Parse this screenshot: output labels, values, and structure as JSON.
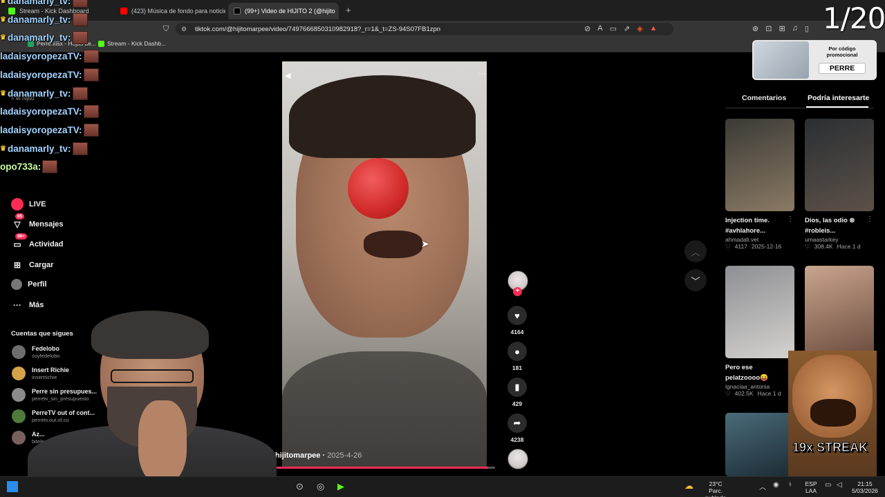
{
  "browser": {
    "tabs": [
      {
        "label": "Stream - Kick Dashboard",
        "active": false
      },
      {
        "label": "(423) Música de fondo para noticiero",
        "active": false
      },
      {
        "label": "(99+) Video de HIJITO 2 (@hijito",
        "active": true
      }
    ],
    "url": "tiktok.com/@hijitomarpee/video/7497666850310982918?_r=1&_t=ZS-94S07FB1zpn",
    "bookmarks": [
      "Perre.xlsx - Hojas de...",
      "Stream - Kick Dashb..."
    ],
    "new_tab_symbol": "+"
  },
  "chat_overlay": [
    {
      "name": "danamarly_tv:",
      "style": "crown"
    },
    {
      "name": "danamarly_tv:",
      "style": "crown"
    },
    {
      "name": "danamarly_tv:",
      "style": "crown"
    },
    {
      "name": "ladaisyoropezaTV:",
      "style": "plain"
    },
    {
      "name": "ladaisyoropezaTV:",
      "style": "plain"
    },
    {
      "name": "danamarly_tv:",
      "style": "crown"
    },
    {
      "name": "ladaisyoropezaTV:",
      "style": "plain"
    },
    {
      "name": "ladaisyoropezaTV:",
      "style": "plain"
    },
    {
      "name": "danamarly_tv:",
      "style": "crown"
    },
    {
      "name": "opo733a:",
      "style": "green"
    }
  ],
  "tiktok": {
    "search_placeholder": "el hijito",
    "nav": {
      "live": "LIVE",
      "messages": "Mensajes",
      "messages_badge": "85",
      "activity": "Actividad",
      "activity_badge": "99+",
      "upload": "Cargar",
      "profile": "Perfil",
      "more": "Más"
    },
    "following_header": "Cuentas que sigues",
    "following": [
      {
        "name": "Fedelobo",
        "handle": "soyfedelobo",
        "color": "#6d6d6d"
      },
      {
        "name": "Insert Richie",
        "handle": "insertrichie",
        "color": "#d3a24a"
      },
      {
        "name": "Perre sin presupues...",
        "handle": "perretv_sin_presupuesto",
        "color": "#8b8b8b"
      },
      {
        "name": "PerreTV out of cont...",
        "handle": "perretv.out.of.co",
        "color": "#4f7a3d"
      },
      {
        "name": "Az...",
        "handle": "bitele...",
        "color": "#7a5f5f"
      }
    ],
    "video": {
      "author": "hijitomarpee",
      "date": "2025-4-26",
      "likes": "4164",
      "comments": "181",
      "saves": "429",
      "shares": "4238",
      "progress": 0.97
    },
    "right_panel": {
      "tabs": [
        "Comentarios",
        "Podría interesarte"
      ],
      "active_tab": "Podría interesarte",
      "promo_text": "Por código promocional",
      "promo_code": "PERRE",
      "cards": [
        {
          "title1": "Injection time.",
          "title2": "#avhlahore...",
          "user": "ahmadali.vet",
          "likes": "4117",
          "date": "2025-12-16",
          "c1": "#3b3a36",
          "c2": "#8a7a64"
        },
        {
          "title1": "Dios, las odio ⊗",
          "title2": "#robleis...",
          "user": "umaastarkey",
          "likes": "308.4K",
          "date": "Hace 1 d",
          "c1": "#2b2f33",
          "c2": "#5c5148"
        },
        {
          "title1": "Pero ese",
          "title2": "pelatzoooo😝",
          "user": "ignaciaa_antonia",
          "likes": "402.5K",
          "date": "Hace 1 d",
          "c1": "#8e8f93",
          "c2": "#d4d2cf"
        },
        {
          "title1": "",
          "title2": "",
          "user": "",
          "likes": "",
          "date": "",
          "c1": "#4a6b7a",
          "c2": "#1b2b33"
        },
        {
          "title1": "",
          "title2": "",
          "user": "",
          "likes": "",
          "date": "",
          "c1": "#c9a58e",
          "c2": "#6a4a3c"
        }
      ]
    }
  },
  "overlays": {
    "counter": "1/20",
    "streak": "19x STREAK"
  },
  "taskbar": {
    "weather_temp": "23°C",
    "weather_desc": "Parc. nublado",
    "lang_top": "ESP",
    "lang_bottom": "LAA",
    "time": "21:15",
    "date": "5/03/2026"
  },
  "colors": {
    "accent": "#fe2c55",
    "chat_name": "#a3d4ff",
    "background": "#000000"
  }
}
